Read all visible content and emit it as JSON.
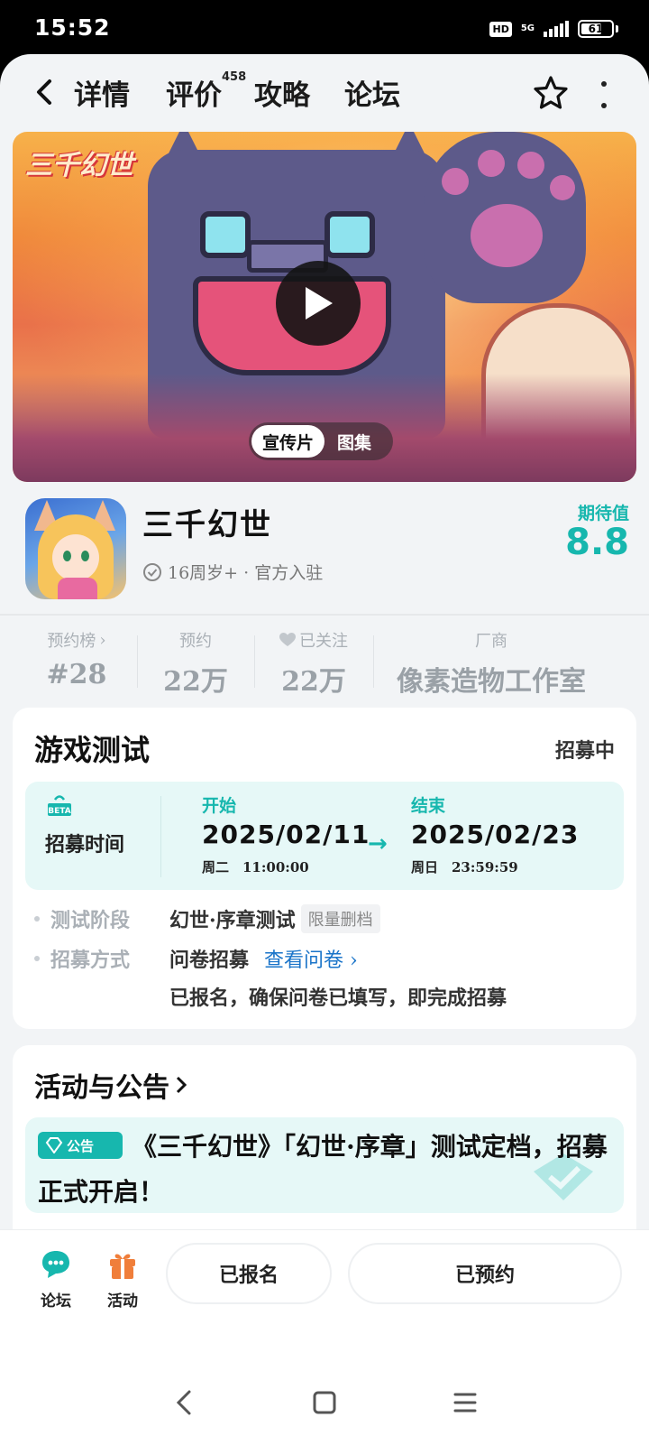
{
  "status_bar": {
    "time": "15:52",
    "hd": "HD",
    "network": "5G",
    "battery": "61"
  },
  "nav": {
    "tabs": [
      {
        "label": "详情",
        "active": true
      },
      {
        "label": "评价",
        "badge": "458"
      },
      {
        "label": "攻略"
      },
      {
        "label": "论坛"
      }
    ],
    "icons": [
      "back-arrow-icon",
      "star-icon",
      "more-vertical-icon"
    ]
  },
  "banner": {
    "logo_text": "三千幻世",
    "media_tabs": [
      "宣传片",
      "图集"
    ],
    "play_icon": "play-icon"
  },
  "app": {
    "name": "三千幻世",
    "meta": "16周岁+ · 官方入驻",
    "expect_label": "期待值",
    "expect_value": "8.8",
    "accent_color": "#17b7ae"
  },
  "stats": {
    "rank_label": "预约榜",
    "rank_value": "#28",
    "reserve_label": "预约",
    "reserve_value": "22万",
    "follow_label": "已关注",
    "follow_value": "22万",
    "vendor_label": "厂商",
    "vendor_value": "像素造物工作室"
  },
  "test": {
    "title": "游戏测试",
    "status": "招募中",
    "beta_text": "BETA",
    "time_label": "招募时间",
    "start_label": "开始",
    "start_date": "2025/02/11",
    "start_sub": "周二　11:00:00",
    "end_label": "结束",
    "end_date": "2025/02/23",
    "end_sub": "周日　23:59:59",
    "arrow": "→",
    "phase_label": "测试阶段",
    "phase_value": "幻世·序章测试",
    "phase_tag": "限量删档",
    "method_label": "招募方式",
    "method_value": "问卷招募",
    "method_link": "查看问卷 ›",
    "method_note": "已报名，确保问卷已填写，即完成招募"
  },
  "announce": {
    "title": "活动与公告",
    "badge": "公告",
    "text": "《三千幻世》「幻世·序章」测试定档，招募正式开启！"
  },
  "bottom": {
    "forum_label": "论坛",
    "activity_label": "活动",
    "signup_btn": "已报名",
    "reserved_btn": "已预约"
  }
}
